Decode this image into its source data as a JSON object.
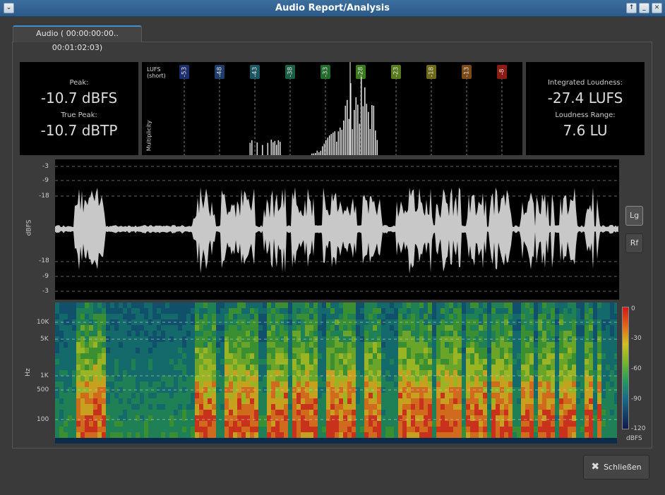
{
  "window": {
    "title": "Audio Report/Analysis"
  },
  "tab": {
    "label": "Audio ( 00:00:00:00.. 00:01:02:03)"
  },
  "peak": {
    "peak_label": "Peak:",
    "peak_value": "-10.7 dBFS",
    "true_peak_label": "True Peak:",
    "true_peak_value": "-10.7 dBTP"
  },
  "loudness": {
    "integrated_label": "Integrated Loudness:",
    "integrated_value": "-27.4 LUFS",
    "range_label": "Loudness Range:",
    "range_value": "7.6 LU"
  },
  "histogram": {
    "lufs_label": "LUFS",
    "lufs_sub": "(short)",
    "y_label": "Multiplicity",
    "markers": [
      {
        "label": "-53",
        "color": "#1d2f6a"
      },
      {
        "label": "-48",
        "color": "#1e3e6a"
      },
      {
        "label": "-43",
        "color": "#1c5560"
      },
      {
        "label": "-38",
        "color": "#1d5f45"
      },
      {
        "label": "-33",
        "color": "#236a2a"
      },
      {
        "label": "-28",
        "color": "#3c7a1e"
      },
      {
        "label": "-23",
        "color": "#567a1c"
      },
      {
        "label": "-18",
        "color": "#6e6a1a"
      },
      {
        "label": "-13",
        "color": "#7a4a18"
      },
      {
        "label": "-8",
        "color": "#8a1c14"
      }
    ]
  },
  "waveform": {
    "y_label": "dBFS",
    "ticks_top": [
      "-3",
      "-9",
      "-18"
    ],
    "ticks_bottom": [
      "-18",
      "-9",
      "-3"
    ]
  },
  "spectrogram": {
    "y_label": "Hz",
    "ticks": [
      "10K",
      "5K",
      "1K",
      "500",
      "100"
    ],
    "scale_label": "dBFS",
    "scale_ticks": [
      "0",
      "-30",
      "-60",
      "-90",
      "-120"
    ]
  },
  "side_buttons": {
    "lg": "Lg",
    "rf": "Rf"
  },
  "footer": {
    "close_label": "Schließen"
  }
}
